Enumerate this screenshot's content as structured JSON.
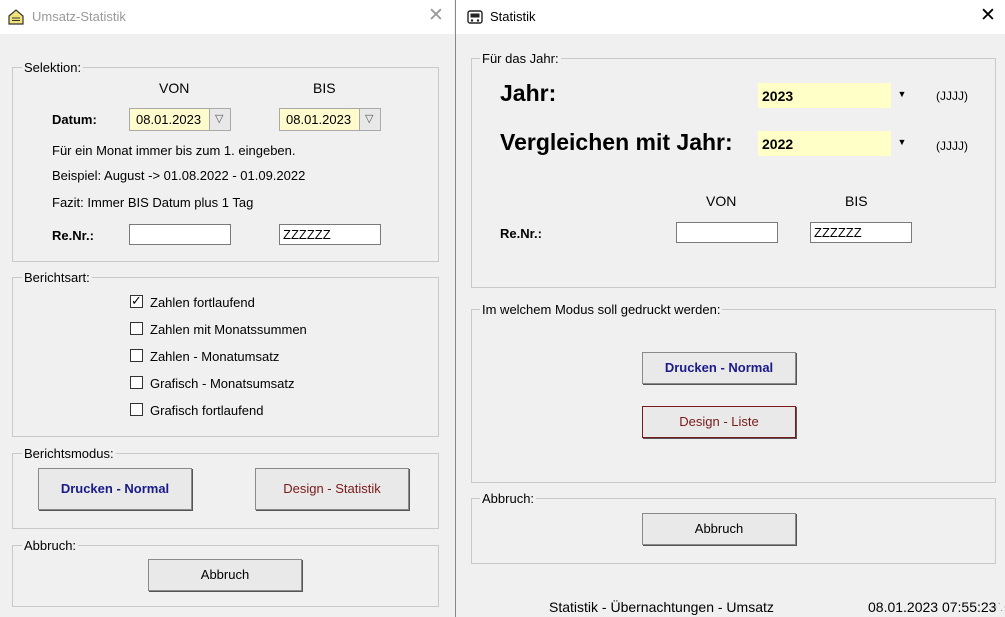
{
  "left_window": {
    "title": "Umsatz-Statistik",
    "close_glyph": "✕",
    "selection": {
      "legend": "Selektion:",
      "von_header": "VON",
      "bis_header": "BIS",
      "datum_label": "Datum:",
      "von_date": "08.01.2023",
      "bis_date": "08.01.2023",
      "hint1": "Für ein Monat immer bis zum 1. eingeben.",
      "hint2": "Beispiel: August -> 01.08.2022 - 01.09.2022",
      "hint3": "Fazit: Immer BIS Datum plus 1 Tag",
      "renr_label": "Re.Nr.:",
      "renr_von": "",
      "renr_bis": "ZZZZZZ"
    },
    "report_type": {
      "legend": "Berichtsart:",
      "options": [
        {
          "label": "Zahlen fortlaufend",
          "checked": true
        },
        {
          "label": "Zahlen mit Monatssummen",
          "checked": false
        },
        {
          "label": "Zahlen - Monatumsatz",
          "checked": false
        },
        {
          "label": "Grafisch - Monatsumsatz",
          "checked": false
        },
        {
          "label": "Grafisch fortlaufend",
          "checked": false
        }
      ]
    },
    "report_mode": {
      "legend": "Berichtsmodus:",
      "print_label": "Drucken - Normal",
      "design_label": "Design - Statistik"
    },
    "abort": {
      "legend": "Abbruch:",
      "button_label": "Abbruch"
    }
  },
  "right_window": {
    "title": "Statistik",
    "close_glyph": "✕",
    "year_group": {
      "legend": "Für das Jahr:",
      "year_label": "Jahr:",
      "year_value": "2023",
      "year_format": "(JJJJ)",
      "compare_label": "Vergleichen mit Jahr:",
      "compare_value": "2022",
      "compare_format": "(JJJJ)",
      "von_header": "VON",
      "bis_header": "BIS",
      "renr_label": "Re.Nr.:",
      "renr_von": "",
      "renr_bis": "ZZZZZZ"
    },
    "print_group": {
      "legend": "Im welchem Modus soll gedruckt werden:",
      "print_label": "Drucken - Normal",
      "design_label": "Design - Liste"
    },
    "abort": {
      "legend": "Abbruch:",
      "button_label": "Abbruch"
    },
    "status": {
      "text": "Statistik - Übernachtungen - Umsatz",
      "datetime": "08.01.2023 07:55:23"
    }
  },
  "colors": {
    "print_button_text": "#1a1a8c",
    "design_button_text": "#7a1a1a",
    "combo_bg": "#fffbcc"
  }
}
